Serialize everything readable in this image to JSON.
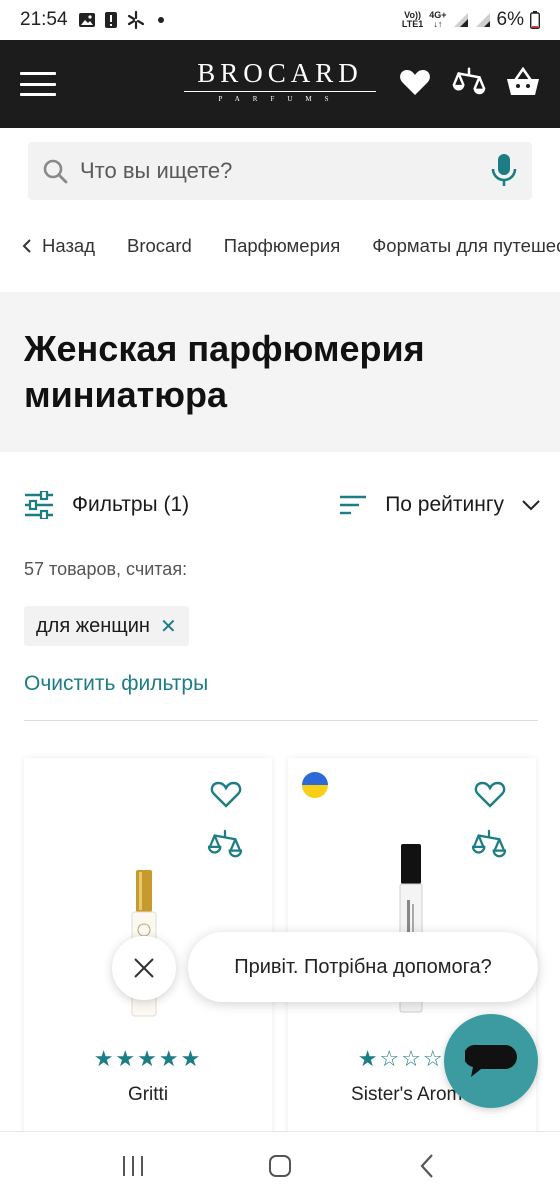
{
  "status_bar": {
    "time": "21:54",
    "network_top": "Vo))",
    "network_bottom": "LTE1",
    "network_type": "4G+",
    "battery": "6%"
  },
  "header": {
    "logo_main": "BROCARD",
    "logo_sub": "PARFUMS",
    "icons": [
      "menu-icon",
      "heart-icon",
      "compare-icon",
      "basket-icon"
    ]
  },
  "search": {
    "placeholder": "Что вы ищете?"
  },
  "breadcrumbs": {
    "back": "Назад",
    "items": [
      "Brocard",
      "Парфюмерия",
      "Форматы для путешествий"
    ]
  },
  "page": {
    "title": "Женская парфюмерия миниатюра"
  },
  "filters": {
    "label": "Фильтры (1)",
    "sort_label": "По рейтингу",
    "count_text": "57 товаров, считая:",
    "chip": "для женщин",
    "clear": "Очистить фильтры"
  },
  "products": [
    {
      "name": "Gritti",
      "rating": 5,
      "flag": false
    },
    {
      "name": "Sister's Aroma",
      "rating": 1,
      "flag": true
    }
  ],
  "chat": {
    "message": "Привіт. Потрібна допомога?"
  },
  "colors": {
    "accent": "#1d7d85",
    "header_bg": "#1c1c1c",
    "fab": "#3c9ba0"
  }
}
